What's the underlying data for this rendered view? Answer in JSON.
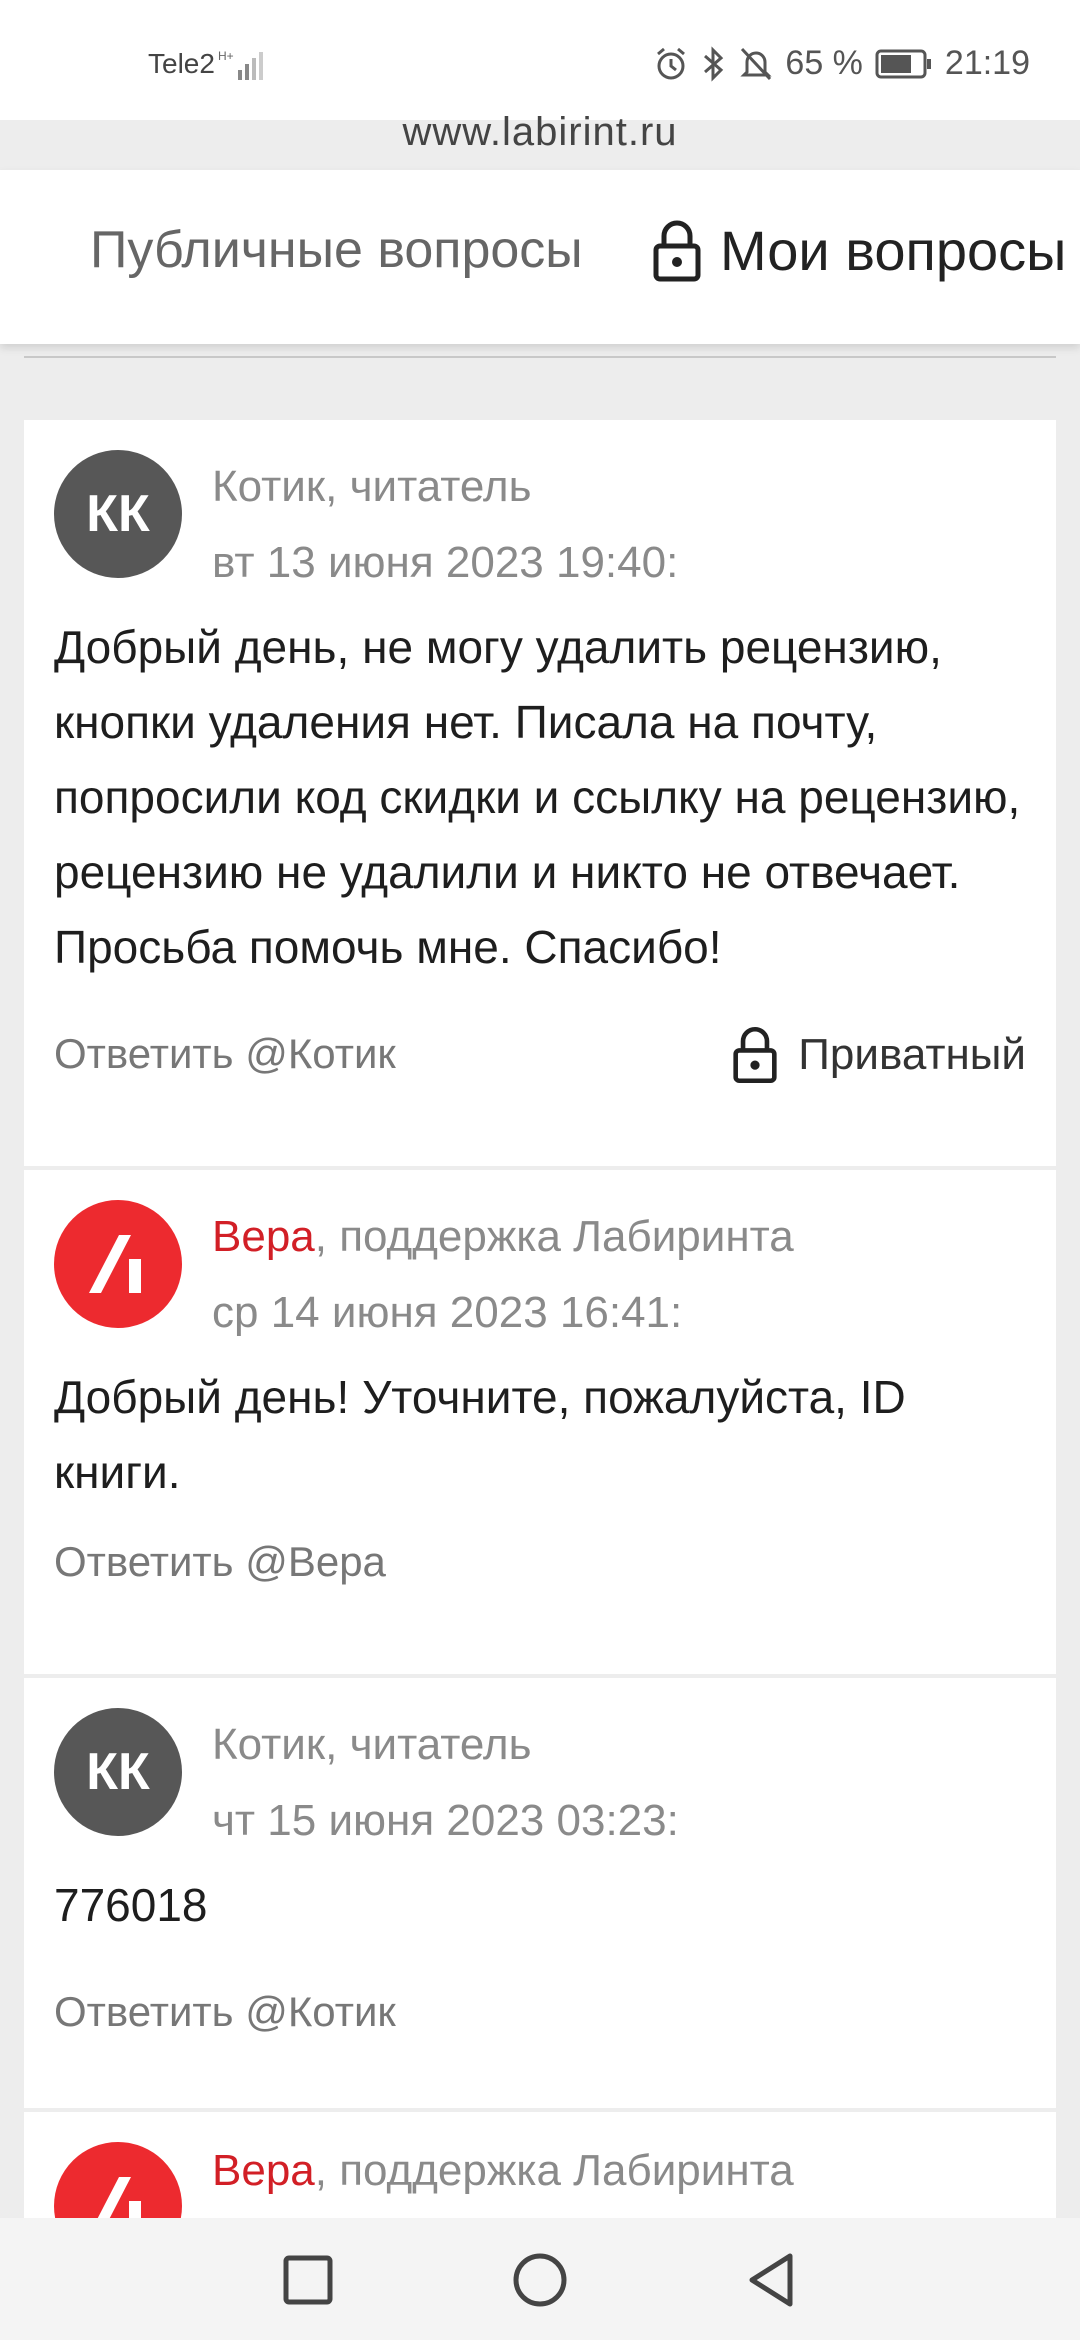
{
  "status": {
    "carrier": "Tele2",
    "battery": "65 %",
    "time": "21:19",
    "icons": [
      "signal-icon",
      "alarm-icon",
      "bluetooth-icon",
      "mute-icon",
      "battery-icon"
    ]
  },
  "browser": {
    "url": "www.labirint.ru"
  },
  "tabs": {
    "public": "Публичные вопросы",
    "mine": "Мои вопросы"
  },
  "messages": [
    {
      "avatar": "КК",
      "author": "Котик, читатель",
      "date": "вт 13 июня 2023 19:40:",
      "text": "Добрый день, не могу удалить рецензию, кнопки удаления нет. Писала на почту, попросили код скидки и ссылку на рецензию, рецензию не удалили и никто не отвечает. Просьба помочь мне. Спасибо!",
      "reply": "Ответить @Котик",
      "private_label": "Приватный"
    },
    {
      "author_name": "Вера",
      "author_role": ", поддержка Лабиринта",
      "date": "ср 14 июня 2023 16:41:",
      "text": "Добрый день! Уточните, пожалуйста, ID книги.",
      "reply": "Ответить @Вера"
    },
    {
      "avatar": "КК",
      "author": "Котик, читатель",
      "date": "чт 15 июня 2023 03:23:",
      "text": "776018",
      "reply": "Ответить @Котик"
    },
    {
      "author_name": "Вера",
      "author_role": ", поддержка Лабиринта"
    }
  ],
  "colors": {
    "accent_red": "#d21f26",
    "avatar_gray": "#575757",
    "background": "#ededed"
  }
}
